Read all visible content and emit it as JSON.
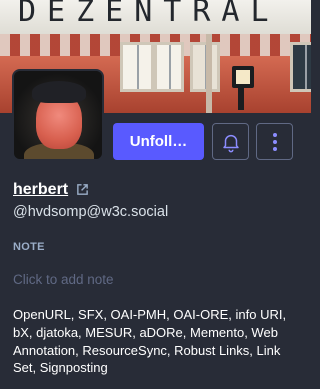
{
  "header": {
    "sign_text": "DEZENTRAL"
  },
  "actions": {
    "follow_label": "Unfoll…",
    "bell_icon": "bell-icon",
    "more_icon": "vertical-ellipsis-icon"
  },
  "profile": {
    "display_name": "herbert",
    "handle": "@hvdsomp@w3c.social",
    "external_link_icon": "external-link-icon"
  },
  "note": {
    "label": "NOTE",
    "placeholder": "Click to add note"
  },
  "bio": {
    "text": "OpenURL, SFX, OAI-PMH, OAI-ORE, info URI, bX, djatoka, MESUR, aDORe, Memento, Web Annotation, ResourceSync, Robust Links, Link Set, Signposting"
  },
  "colors": {
    "background": "#282c37",
    "accent": "#595aff",
    "secondary_text": "#9baec8",
    "muted_text": "#606984"
  }
}
